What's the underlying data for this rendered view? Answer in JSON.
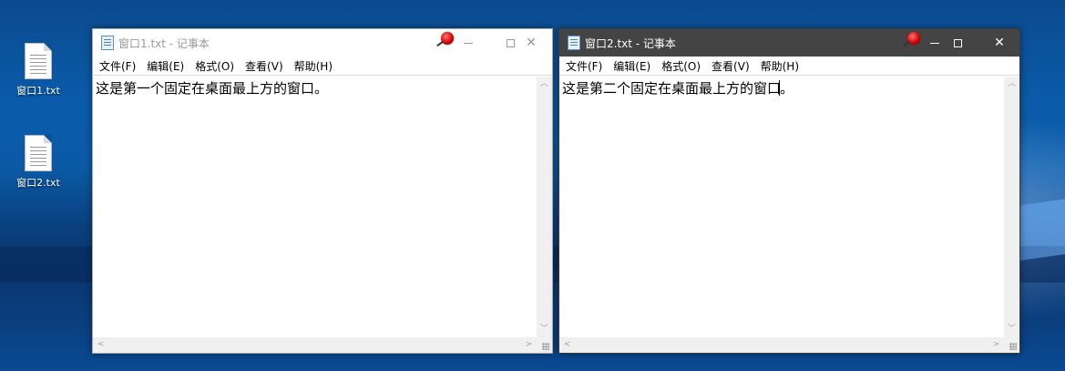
{
  "desktop": {
    "icons": [
      {
        "label": "窗口1.txt"
      },
      {
        "label": "窗口2.txt"
      }
    ]
  },
  "windows": [
    {
      "title": "窗口1.txt - 记事本",
      "active": false,
      "menu": [
        "文件(F)",
        "编辑(E)",
        "格式(O)",
        "查看(V)",
        "帮助(H)"
      ],
      "content": "这是第一个固定在桌面最上方的窗口。",
      "controls": {
        "minimize": "—",
        "maximize": "□",
        "close": "✕"
      }
    },
    {
      "title": "窗口2.txt - 记事本",
      "active": true,
      "menu": [
        "文件(F)",
        "编辑(E)",
        "格式(O)",
        "查看(V)",
        "帮助(H)"
      ],
      "content": "这是第二个固定在桌面最上方的窗口",
      "content_tail": "。",
      "controls": {
        "minimize": "—",
        "maximize": "□",
        "close": "✕"
      }
    }
  ],
  "colors": {
    "active_titlebar": "#444444",
    "inactive_titlebar": "#ffffff",
    "pin": "#d00000",
    "desktop_blue": "#0a5cab"
  },
  "icons": {
    "pin": "red-pushpin-icon",
    "notepad": "notepad-icon",
    "file": "text-file-icon"
  }
}
